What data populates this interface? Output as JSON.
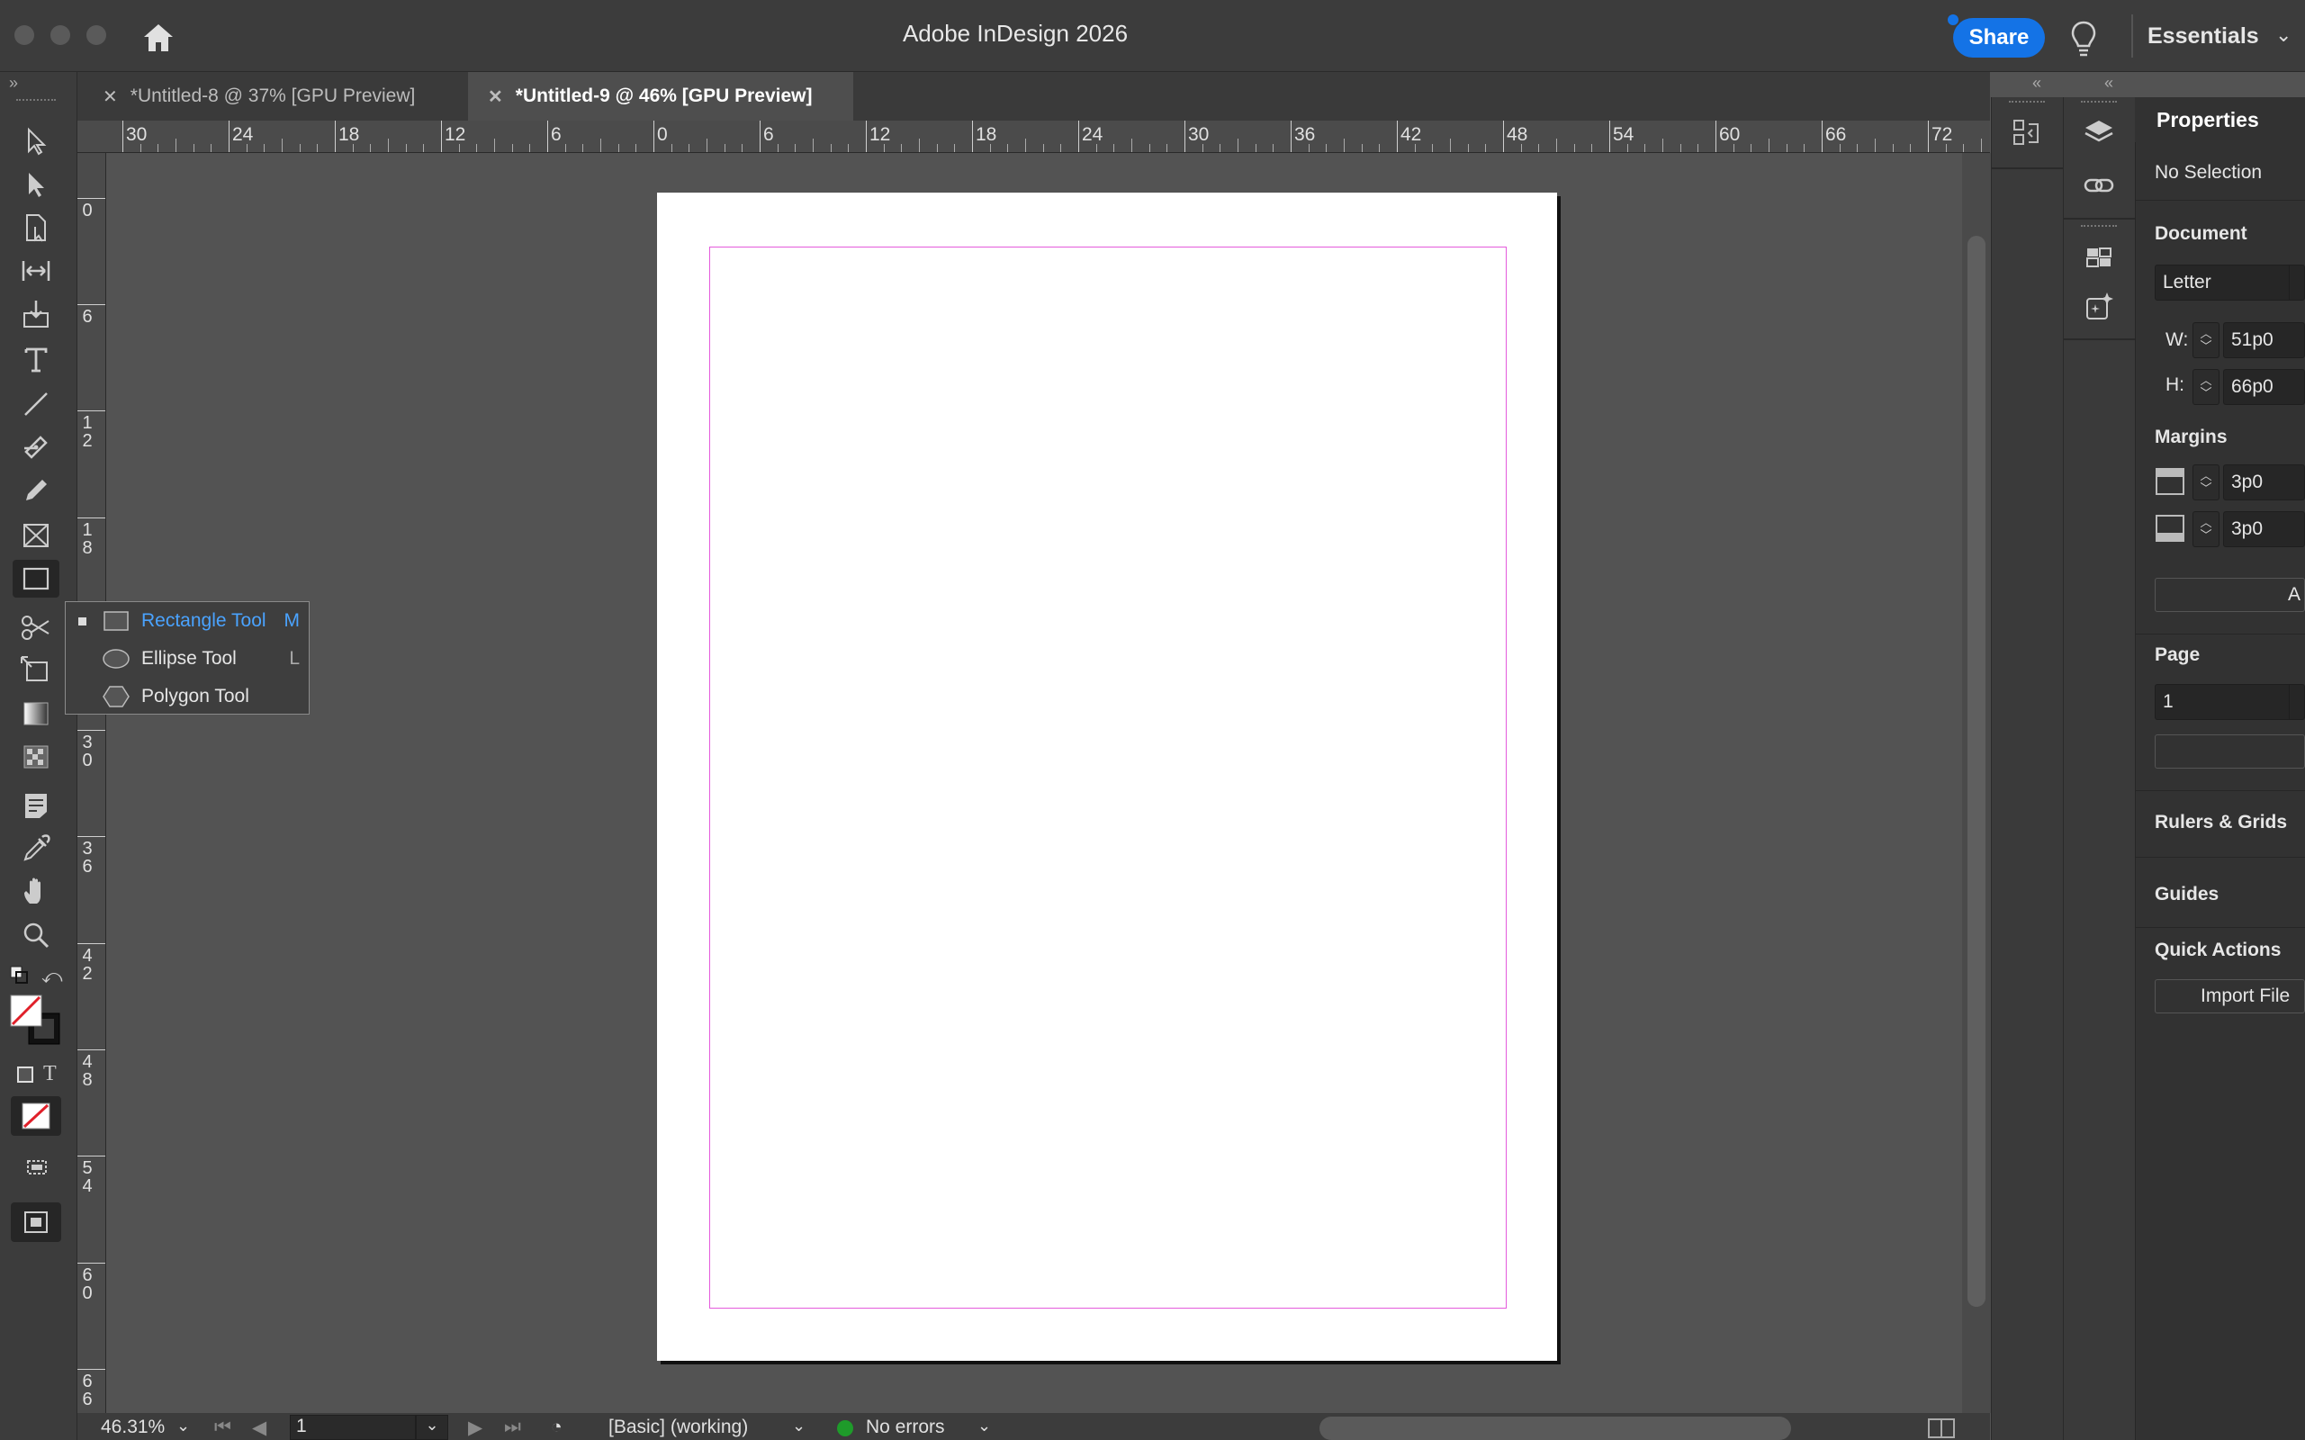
{
  "app": {
    "title": "Adobe InDesign 2026",
    "share_label": "Share",
    "workspace": "Essentials"
  },
  "tabs": [
    {
      "label": "*Untitled-8 @ 37% [GPU Preview]",
      "active": false
    },
    {
      "label": "*Untitled-9 @ 46% [GPU Preview]",
      "active": true
    }
  ],
  "ruler": {
    "horizontal": [
      "30",
      "24",
      "18",
      "12",
      "6",
      "0",
      "6",
      "12",
      "18",
      "24",
      "30",
      "36",
      "42",
      "48",
      "54",
      "60",
      "66",
      "72"
    ],
    "vertical": [
      "0",
      "6",
      "12",
      "18",
      "30",
      "36",
      "42",
      "48",
      "54",
      "60",
      "66"
    ]
  },
  "flyout": {
    "items": [
      {
        "label": "Rectangle Tool",
        "key": "M",
        "selected": true
      },
      {
        "label": "Ellipse Tool",
        "key": "L",
        "selected": false
      },
      {
        "label": "Polygon Tool",
        "key": "",
        "selected": false
      }
    ]
  },
  "status": {
    "zoom": "46.31%",
    "page": "1",
    "profile": "[Basic] (working)",
    "errors": "No errors",
    "errors_color": "#1e9b2a"
  },
  "properties": {
    "tab": "Properties",
    "selection": "No Selection",
    "document_label": "Document",
    "preset": "Letter",
    "w_label": "W:",
    "w_value": "51p0",
    "h_label": "H:",
    "h_value": "66p0",
    "margins_label": "Margins",
    "margin_top": "3p0",
    "margin_bottom": "3p0",
    "adjust_label": "A",
    "page_label": "Page",
    "page_value": "1",
    "rulers_label": "Rulers & Grids",
    "guides_label": "Guides",
    "quick_actions_label": "Quick Actions",
    "import_label": "Import File"
  },
  "colors": {
    "accent": "#1473e6",
    "margin_guide": "#e45bdc",
    "selected_text": "#4aa3ff"
  }
}
